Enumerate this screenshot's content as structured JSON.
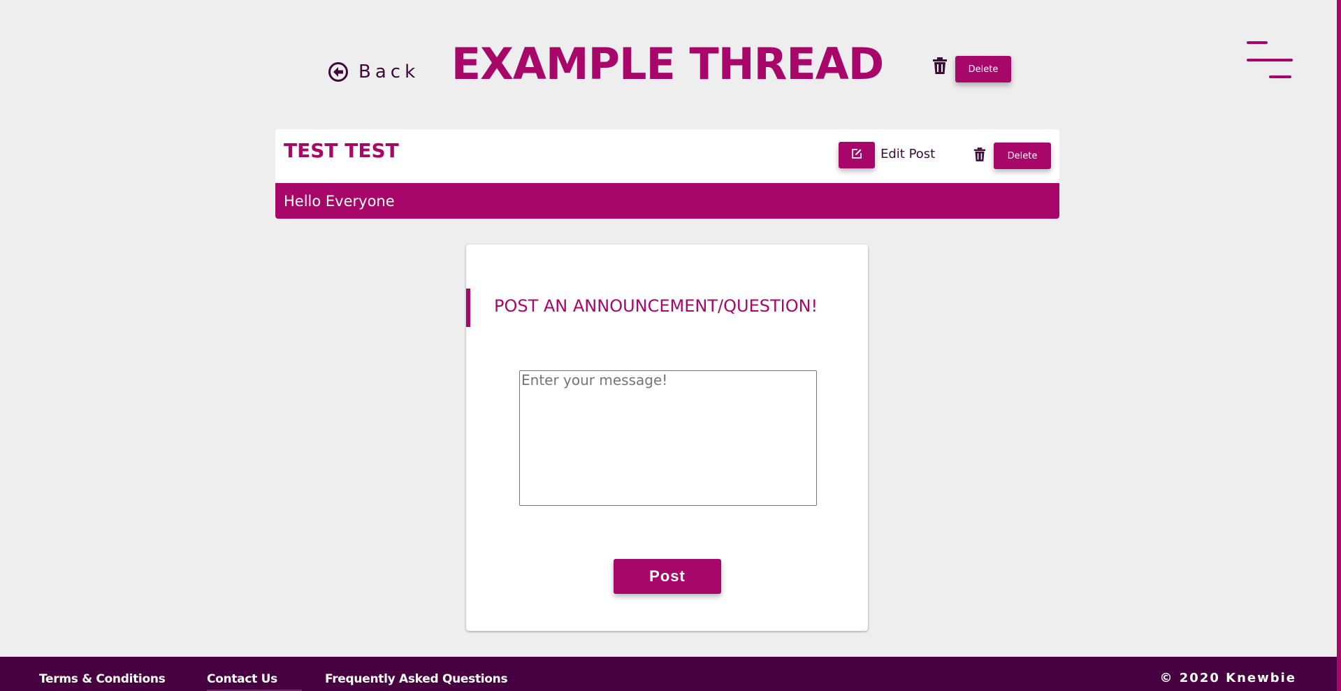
{
  "colors": {
    "primary": "#a8076a",
    "footer": "#470040",
    "text_dark": "#3d0a3a",
    "page_bg": "#eeeeee"
  },
  "header": {
    "back_label": "Back",
    "back_icon": "arrow-circle-left-icon",
    "title": "EXAMPLE THREAD",
    "delete_icon": "trash-icon",
    "delete_label": "Delete",
    "menu_icon": "hamburger-menu-icon"
  },
  "post": {
    "author": "TEST TEST",
    "edit_icon": "pencil-square-icon",
    "edit_label": "Edit Post",
    "delete_icon": "trash-icon",
    "delete_label": "Delete",
    "message": "Hello Everyone"
  },
  "compose": {
    "title": "POST AN ANNOUNCEMENT/QUESTION!",
    "placeholder": "Enter your message!",
    "value": "",
    "submit_label": "Post"
  },
  "footer": {
    "links": [
      {
        "label": "Terms & Conditions"
      },
      {
        "label": "Contact Us"
      },
      {
        "label": "Frequently Asked Questions"
      }
    ],
    "copyright": "© 2020 Knewbie"
  }
}
